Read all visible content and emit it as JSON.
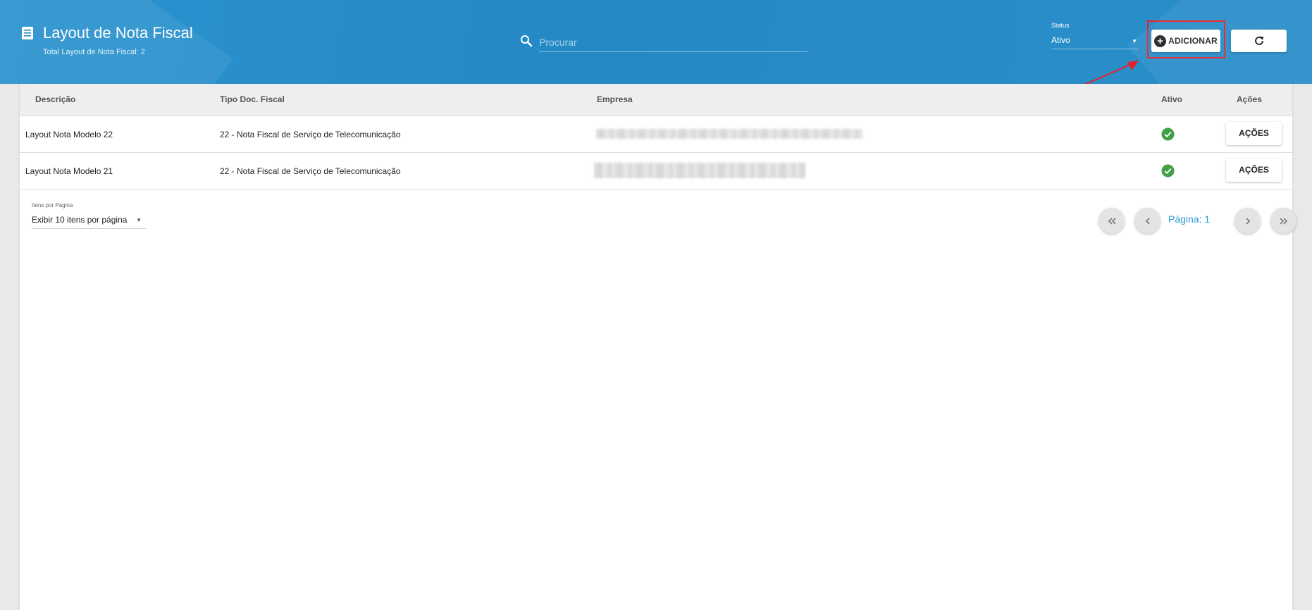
{
  "header": {
    "title": "Layout de Nota Fiscal",
    "subtitle": "Total Layout de Nota Fiscal: 2",
    "search_placeholder": "Procurar",
    "status_label": "Status",
    "status_value": "Ativo",
    "add_button_label": "ADICIONAR",
    "icons": {
      "page": "document-list-icon",
      "search": "search-icon",
      "add": "plus-circle-icon",
      "refresh": "refresh-icon",
      "dropdown": "caret-down-icon"
    }
  },
  "table": {
    "columns": [
      "Descrição",
      "Tipo Doc. Fiscal",
      "Empresa",
      "Ativo",
      "Ações"
    ],
    "rows": [
      {
        "descricao": "Layout Nota Modelo 22",
        "tipo": "22 - Nota Fiscal de Serviço de Telecomunicação",
        "ativo": true,
        "acoes_label": "AÇÕES"
      },
      {
        "descricao": "Layout Nota Modelo 21",
        "tipo": "22 - Nota Fiscal de Serviço de Telecomunicação",
        "ativo": true,
        "acoes_label": "AÇÕES"
      }
    ]
  },
  "footer": {
    "items_per_page_label": "Itens por Página",
    "items_per_page_value": "Exibir 10 itens por página",
    "page_label": "Página: 1"
  },
  "colors": {
    "header_blue": "#2489c5",
    "accent": "#2b9ad6",
    "success": "#43a047",
    "highlight": "#e8202a"
  }
}
